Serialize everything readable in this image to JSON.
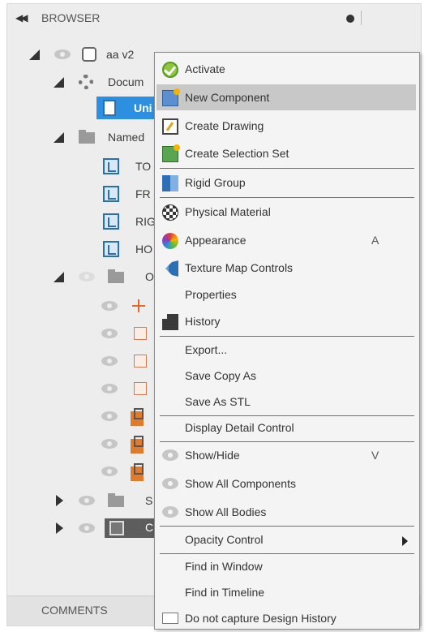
{
  "browser": {
    "title": "BROWSER",
    "collapse_glyph": "◀◀",
    "tree": {
      "root_label": "aa v2",
      "document_settings_label": "Docum",
      "units_label": "Uni",
      "named_views_label": "Named",
      "named_views": [
        "TO",
        "FR",
        "RIG",
        "HO"
      ],
      "origin_label": "O",
      "sketches_label": "S",
      "component_label": "C"
    }
  },
  "comments": {
    "title": "COMMENTS"
  },
  "context_menu": {
    "items": [
      {
        "label": "Activate",
        "icon": "activate-icon"
      },
      {
        "label": "New Component",
        "icon": "new-component-icon",
        "highlighted": true
      },
      {
        "label": "Create Drawing",
        "icon": "create-drawing-icon"
      },
      {
        "label": "Create Selection Set",
        "icon": "selection-set-icon"
      },
      {
        "label": "Rigid Group",
        "icon": "rigid-group-icon"
      },
      {
        "label": "Physical Material",
        "icon": "physical-material-icon"
      },
      {
        "label": "Appearance",
        "icon": "appearance-icon",
        "shortcut": "A"
      },
      {
        "label": "Texture Map Controls",
        "icon": "texture-map-icon"
      },
      {
        "label": "Properties"
      },
      {
        "label": "History",
        "icon": "history-icon"
      },
      {
        "label": "Export..."
      },
      {
        "label": "Save Copy As"
      },
      {
        "label": "Save As STL"
      },
      {
        "label": "Display Detail Control"
      },
      {
        "label": "Show/Hide",
        "icon": "eye-icon",
        "shortcut": "V"
      },
      {
        "label": "Show All Components",
        "icon": "eye-icon"
      },
      {
        "label": "Show All Bodies",
        "icon": "eye-icon"
      },
      {
        "label": "Opacity Control",
        "submenu": true
      },
      {
        "label": "Find in Window"
      },
      {
        "label": "Find in Timeline"
      },
      {
        "label": "Do not capture Design History",
        "icon": "no-capture-icon"
      }
    ]
  }
}
